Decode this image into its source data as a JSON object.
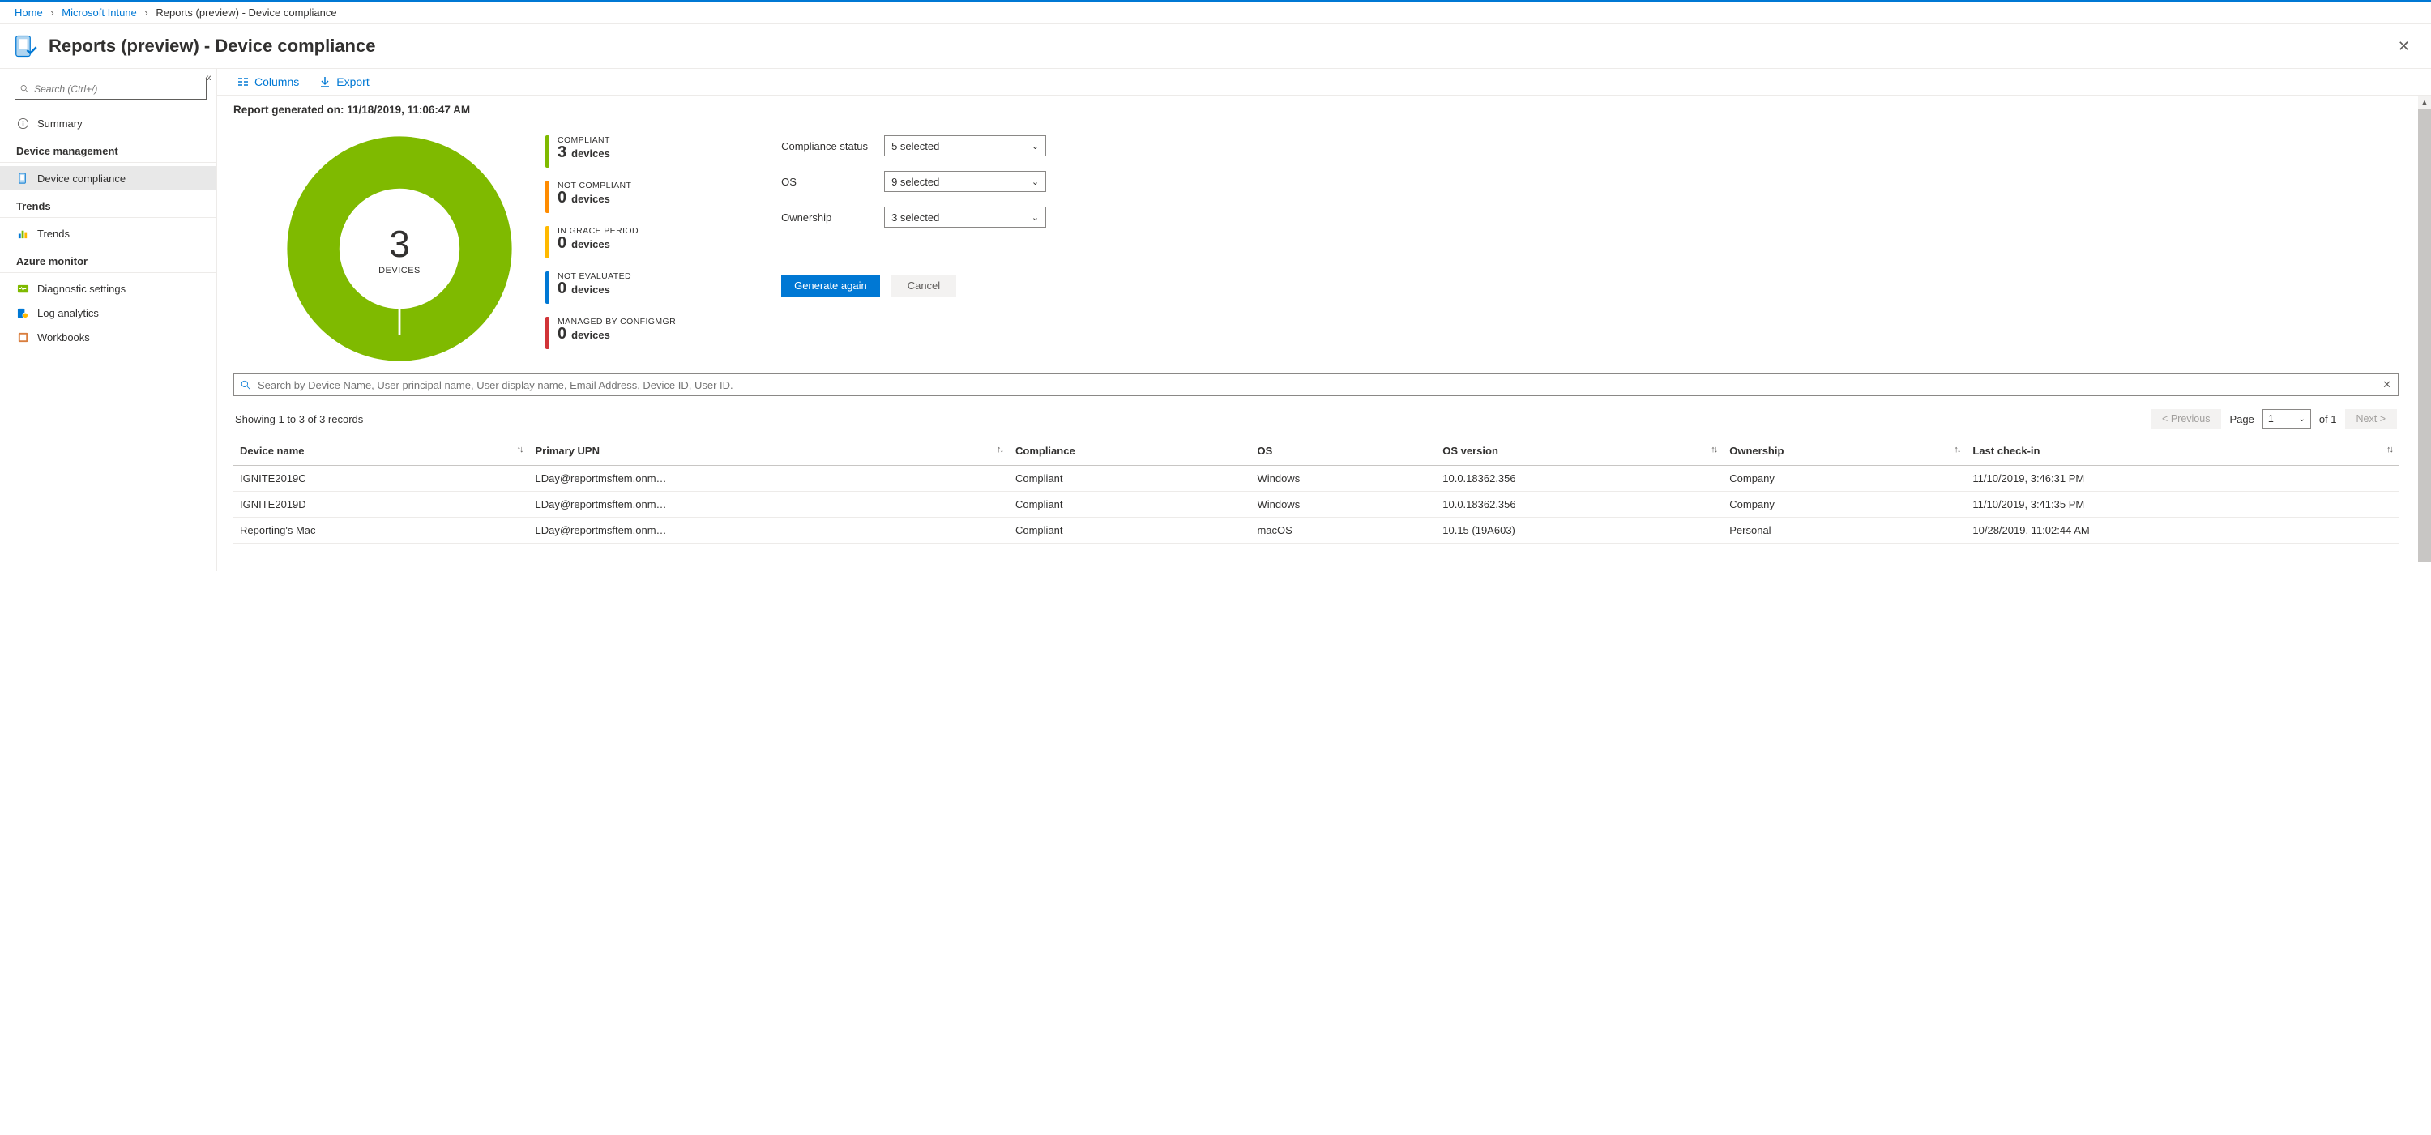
{
  "breadcrumb": {
    "home": "Home",
    "intune": "Microsoft Intune",
    "current": "Reports (preview) - Device compliance"
  },
  "title": "Reports (preview) - Device compliance",
  "search_placeholder": "Search (Ctrl+/)",
  "sidebar": {
    "summary": "Summary",
    "sections": [
      "Device management",
      "Trends",
      "Azure monitor"
    ],
    "items": {
      "device_compliance": "Device compliance",
      "trends": "Trends",
      "diagnostic_settings": "Diagnostic settings",
      "log_analytics": "Log analytics",
      "workbooks": "Workbooks"
    }
  },
  "toolbar": {
    "columns": "Columns",
    "export": "Export"
  },
  "report_generated_label": "Report generated on: ",
  "report_generated_value": "11/18/2019, 11:06:47 AM",
  "chart_data": {
    "type": "pie",
    "title": "DEVICES",
    "center_value": 3,
    "series": [
      {
        "name": "COMPLIANT",
        "value": 3,
        "color": "#7fba00"
      },
      {
        "name": "NOT COMPLIANT",
        "value": 0,
        "color": "#ff8c00"
      },
      {
        "name": "IN GRACE PERIOD",
        "value": 0,
        "color": "#ffb900"
      },
      {
        "name": "NOT EVALUATED",
        "value": 0,
        "color": "#0078d4"
      },
      {
        "name": "MANAGED BY CONFIGMGR",
        "value": 0,
        "color": "#d13438"
      }
    ],
    "unit": "devices"
  },
  "filters": {
    "compliance_status": {
      "label": "Compliance status",
      "value": "5 selected"
    },
    "os": {
      "label": "OS",
      "value": "9 selected"
    },
    "ownership": {
      "label": "Ownership",
      "value": "3 selected"
    }
  },
  "actions": {
    "generate": "Generate again",
    "cancel": "Cancel"
  },
  "table": {
    "search_placeholder": "Search by Device Name, User principal name, User display name, Email Address, Device ID, User ID.",
    "showing": "Showing 1 to 3 of 3 records",
    "prev": "< Previous",
    "next": "Next >",
    "page_label": "Page",
    "page_value": "1",
    "page_total": "of 1",
    "columns": [
      "Device name",
      "Primary UPN",
      "Compliance",
      "OS",
      "OS version",
      "Ownership",
      "Last check-in"
    ],
    "rows": [
      {
        "device": "IGNITE2019C",
        "upn": "LDay@reportmsftem.onm…",
        "compliance": "Compliant",
        "os": "Windows",
        "osver": "10.0.18362.356",
        "owner": "Company",
        "checkin": "11/10/2019, 3:46:31 PM"
      },
      {
        "device": "IGNITE2019D",
        "upn": "LDay@reportmsftem.onm…",
        "compliance": "Compliant",
        "os": "Windows",
        "osver": "10.0.18362.356",
        "owner": "Company",
        "checkin": "11/10/2019, 3:41:35 PM"
      },
      {
        "device": "Reporting's Mac",
        "upn": "LDay@reportmsftem.onm…",
        "compliance": "Compliant",
        "os": "macOS",
        "osver": "10.15 (19A603)",
        "owner": "Personal",
        "checkin": "10/28/2019, 11:02:44 AM"
      }
    ]
  }
}
